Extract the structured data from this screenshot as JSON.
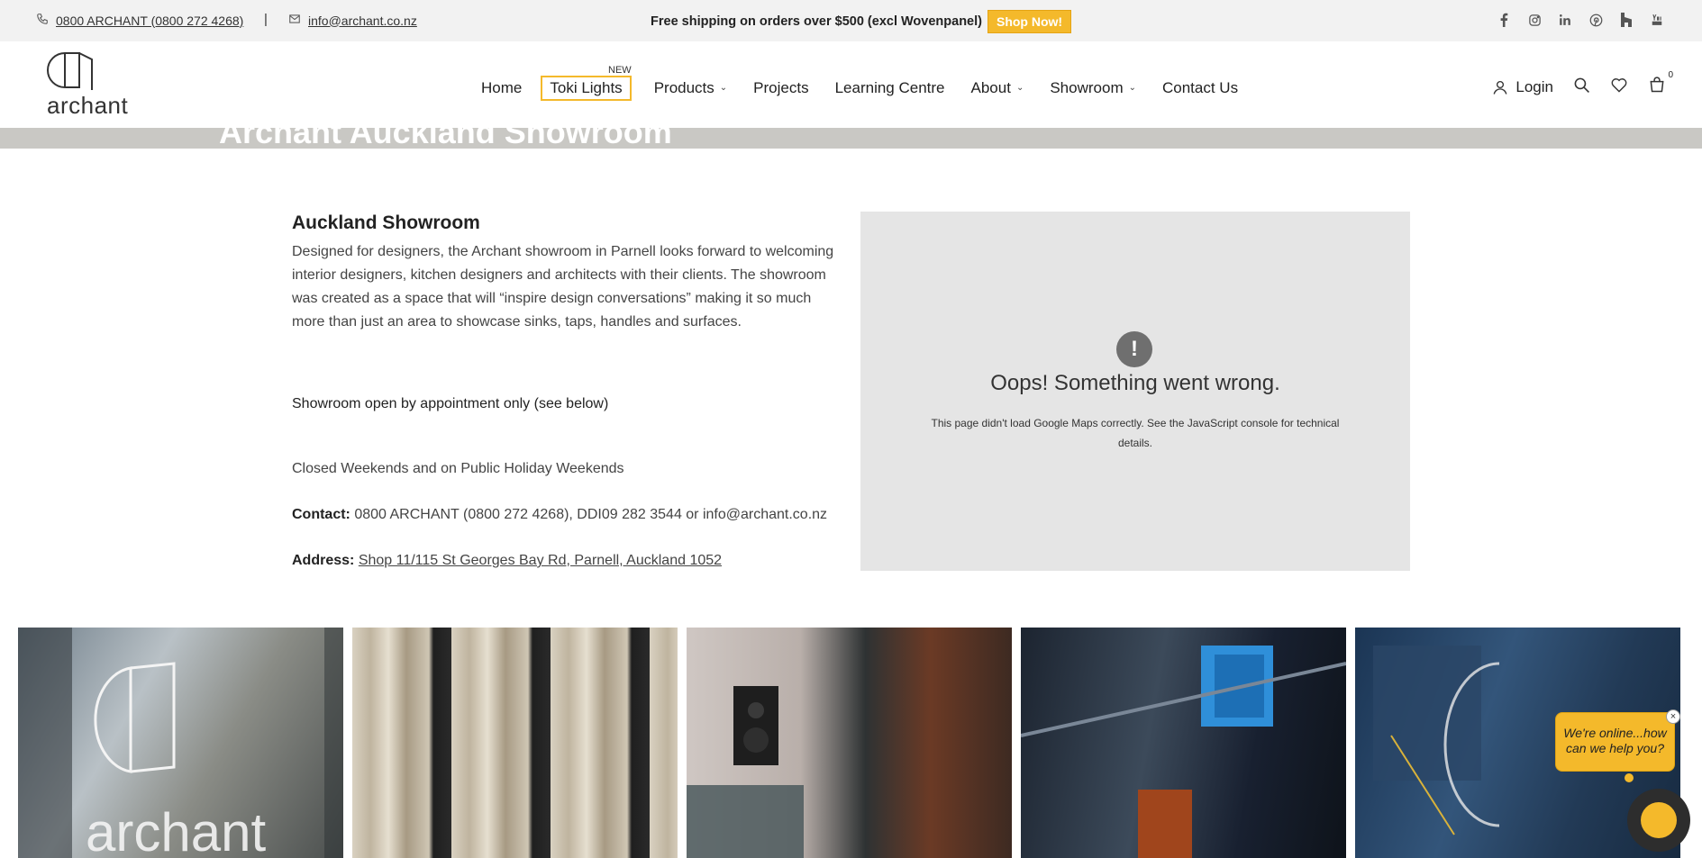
{
  "topbar": {
    "phone": "0800 ARCHANT (0800 272 4268)",
    "separator": "|",
    "email": "info@archant.co.nz",
    "promo": "Free shipping on orders over $500 (excl Wovenpanel)",
    "shop_now": "Shop Now!",
    "social_icons": [
      "facebook-icon",
      "instagram-icon",
      "linkedin-icon",
      "pinterest-icon",
      "houzz-icon",
      "youtube-icon"
    ]
  },
  "header": {
    "logo_text": "archant",
    "nav": {
      "home": "Home",
      "toki": "Toki Lights",
      "toki_badge": "NEW",
      "products": "Products",
      "projects": "Projects",
      "learning": "Learning Centre",
      "about": "About",
      "showroom": "Showroom",
      "contact": "Contact Us"
    },
    "login": "Login",
    "cart_count": "0"
  },
  "hero": {
    "title": "Archant Auckland Showroom"
  },
  "content": {
    "title": "Auckland Showroom",
    "paragraph": "Designed for designers, the Archant showroom in Parnell looks forward to welcoming interior designers, kitchen designers and architects with their clients. The showroom was created as a space that will “inspire design conversations” making it so much more than just an area to showcase sinks, taps, handles and surfaces.",
    "appointment": "Showroom open by appointment only (see below)",
    "closed": "Closed Weekends and on Public Holiday Weekends",
    "contact_label": "Contact:",
    "contact_value": " 0800 ARCHANT (0800 272 4268), DDI09 282 3544  or info@archant.co.nz",
    "address_label": "Address:",
    "address_value": "Shop 11/115 St Georges Bay Rd, Parnell, Auckland 1052"
  },
  "map": {
    "icon": "!",
    "title": "Oops! Something went wrong.",
    "message": "This page didn't load Google Maps correctly. See the JavaScript console for technical details."
  },
  "gallery": {
    "logo_overlay": "archant"
  },
  "chat": {
    "bubble": "We're online...how can we help you?",
    "close": "×"
  },
  "colors": {
    "accent": "#f4b92b",
    "map_bg": "#e5e5e5",
    "hero_strip": "#c9c8c4"
  }
}
